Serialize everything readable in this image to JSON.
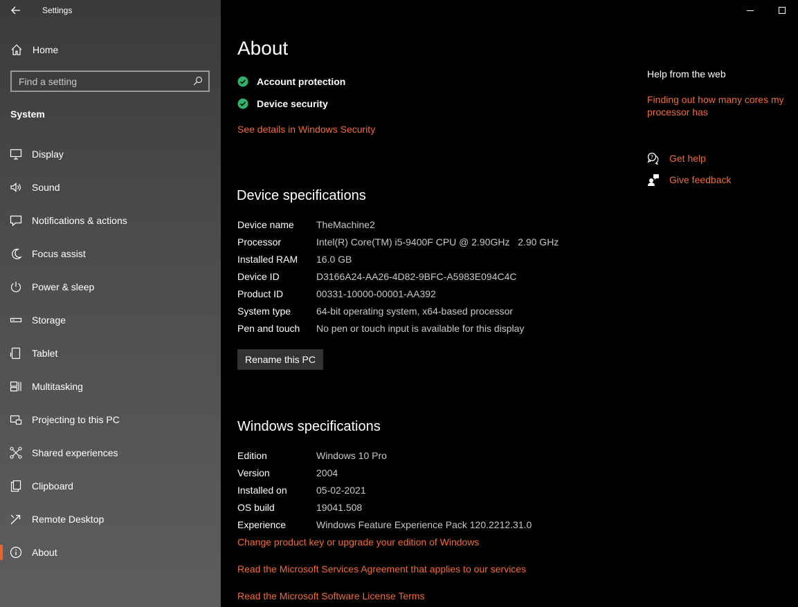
{
  "window": {
    "title": "Settings",
    "minimize_glyph": "—",
    "maximize_glyph": "☐"
  },
  "sidebar": {
    "home_label": "Home",
    "search_placeholder": "Find a setting",
    "section": "System",
    "items": [
      {
        "label": "Display",
        "icon": "display-icon"
      },
      {
        "label": "Sound",
        "icon": "sound-icon"
      },
      {
        "label": "Notifications & actions",
        "icon": "notifications-icon"
      },
      {
        "label": "Focus assist",
        "icon": "focus-assist-icon"
      },
      {
        "label": "Power & sleep",
        "icon": "power-icon"
      },
      {
        "label": "Storage",
        "icon": "storage-icon"
      },
      {
        "label": "Tablet",
        "icon": "tablet-icon"
      },
      {
        "label": "Multitasking",
        "icon": "multitasking-icon"
      },
      {
        "label": "Projecting to this PC",
        "icon": "projecting-icon"
      },
      {
        "label": "Shared experiences",
        "icon": "shared-experiences-icon"
      },
      {
        "label": "Clipboard",
        "icon": "clipboard-icon"
      },
      {
        "label": "Remote Desktop",
        "icon": "remote-desktop-icon"
      },
      {
        "label": "About",
        "icon": "info-icon",
        "active": true
      }
    ]
  },
  "main": {
    "title": "About",
    "security": [
      {
        "label": "Account protection"
      },
      {
        "label": "Device security"
      }
    ],
    "security_link": "See details in Windows Security",
    "device_specs": {
      "heading": "Device specifications",
      "rows": [
        {
          "key": "Device name",
          "value": "TheMachine2"
        },
        {
          "key": "Processor",
          "value": "Intel(R) Core(TM) i5-9400F CPU @ 2.90GHz   2.90 GHz"
        },
        {
          "key": "Installed RAM",
          "value": "16.0 GB"
        },
        {
          "key": "Device ID",
          "value": "D3166A24-AA26-4D82-9BFC-A5983E094C4C"
        },
        {
          "key": "Product ID",
          "value": "00331-10000-00001-AA392"
        },
        {
          "key": "System type",
          "value": "64-bit operating system, x64-based processor"
        },
        {
          "key": "Pen and touch",
          "value": "No pen or touch input is available for this display"
        }
      ],
      "rename_button": "Rename this PC"
    },
    "windows_specs": {
      "heading": "Windows specifications",
      "rows": [
        {
          "key": "Edition",
          "value": "Windows 10 Pro"
        },
        {
          "key": "Version",
          "value": "2004"
        },
        {
          "key": "Installed on",
          "value": "05-02-2021"
        },
        {
          "key": "OS build",
          "value": "19041.508"
        },
        {
          "key": "Experience",
          "value": "Windows Feature Experience Pack 120.2212.31.0"
        }
      ],
      "links": [
        "Change product key or upgrade your edition of Windows",
        "Read the Microsoft Services Agreement that applies to our services",
        "Read the Microsoft Software License Terms"
      ]
    }
  },
  "right_panel": {
    "heading": "Help from the web",
    "web_link": "Finding out how many cores my processor has",
    "get_help": "Get help",
    "give_feedback": "Give feedback"
  },
  "colors": {
    "accent": "#f26b3a",
    "check_green": "#2fb36a",
    "active_bar": "#e8662c"
  }
}
